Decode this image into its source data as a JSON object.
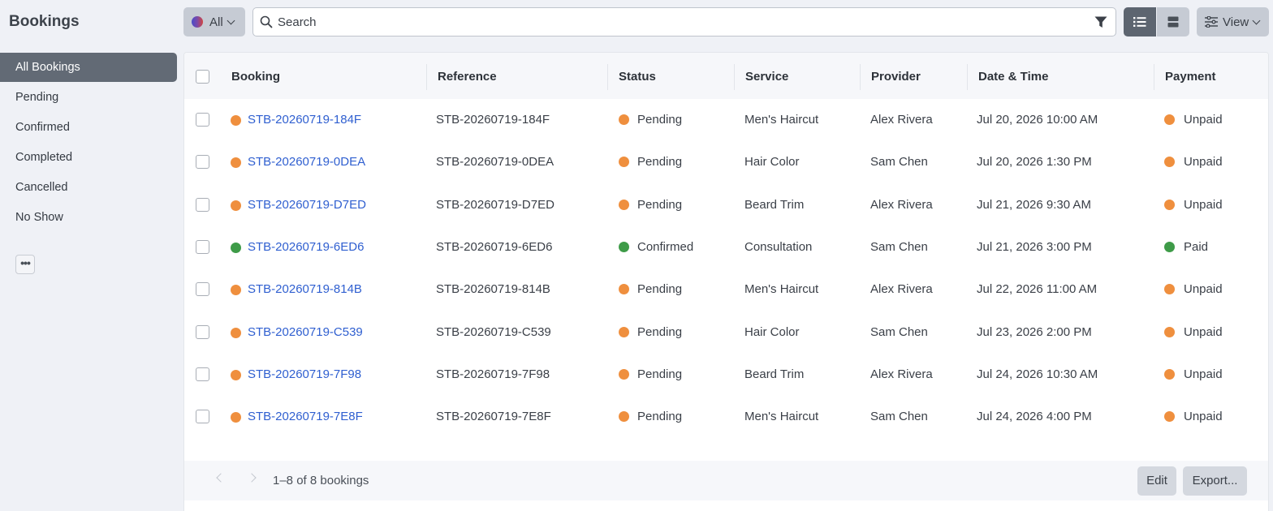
{
  "app": {
    "title": "Bookings"
  },
  "sidebar": {
    "items": [
      {
        "label": "All Bookings"
      },
      {
        "label": "Pending"
      },
      {
        "label": "Confirmed"
      },
      {
        "label": "Completed"
      },
      {
        "label": "Cancelled"
      },
      {
        "label": "No Show"
      }
    ],
    "active": "All Bookings",
    "more_label": "•••"
  },
  "toolbar": {
    "scope_label": "All",
    "search_placeholder": "Search",
    "view_label": "View",
    "active_view": "list"
  },
  "table": {
    "headers": {
      "booking": "Booking",
      "reference": "Reference",
      "status": "Status",
      "service": "Service",
      "provider": "Provider",
      "datetime": "Date & Time",
      "payment": "Payment"
    },
    "rows": [
      {
        "booking": "STB-20260719-184F",
        "reference": "STB-20260719-184F",
        "status": "Pending",
        "service": "Men's Haircut",
        "provider": "Alex Rivera",
        "datetime": "Jul 20, 2026 10:00 AM",
        "payment": "Unpaid"
      },
      {
        "booking": "STB-20260719-0DEA",
        "reference": "STB-20260719-0DEA",
        "status": "Pending",
        "service": "Hair Color",
        "provider": "Sam Chen",
        "datetime": "Jul 20, 2026 1:30 PM",
        "payment": "Unpaid"
      },
      {
        "booking": "STB-20260719-D7ED",
        "reference": "STB-20260719-D7ED",
        "status": "Pending",
        "service": "Beard Trim",
        "provider": "Alex Rivera",
        "datetime": "Jul 21, 2026 9:30 AM",
        "payment": "Unpaid"
      },
      {
        "booking": "STB-20260719-6ED6",
        "reference": "STB-20260719-6ED6",
        "status": "Confirmed",
        "service": "Consultation",
        "provider": "Sam Chen",
        "datetime": "Jul 21, 2026 3:00 PM",
        "payment": "Paid"
      },
      {
        "booking": "STB-20260719-814B",
        "reference": "STB-20260719-814B",
        "status": "Pending",
        "service": "Men's Haircut",
        "provider": "Alex Rivera",
        "datetime": "Jul 22, 2026 11:00 AM",
        "payment": "Unpaid"
      },
      {
        "booking": "STB-20260719-C539",
        "reference": "STB-20260719-C539",
        "status": "Pending",
        "service": "Hair Color",
        "provider": "Sam Chen",
        "datetime": "Jul 23, 2026 2:00 PM",
        "payment": "Unpaid"
      },
      {
        "booking": "STB-20260719-7F98",
        "reference": "STB-20260719-7F98",
        "status": "Pending",
        "service": "Beard Trim",
        "provider": "Alex Rivera",
        "datetime": "Jul 24, 2026 10:30 AM",
        "payment": "Unpaid"
      },
      {
        "booking": "STB-20260719-7E8F",
        "reference": "STB-20260719-7E8F",
        "status": "Pending",
        "service": "Men's Haircut",
        "provider": "Sam Chen",
        "datetime": "Jul 24, 2026 4:00 PM",
        "payment": "Unpaid"
      }
    ]
  },
  "footer": {
    "pagination_text": "1–8 of 8 bookings",
    "edit_label": "Edit",
    "export_label": "Export..."
  },
  "colors": {
    "pending": "#ef8f3e",
    "confirmed": "#3e9b48",
    "unpaid": "#ef8f3e",
    "paid": "#3e9b48",
    "link": "#2f5fd0",
    "active_nav": "#626a75"
  },
  "icons": {
    "scope": "globe-icon",
    "search": "search-icon",
    "filter": "filter-icon",
    "list_view": "list-view-icon",
    "card_view": "card-view-icon",
    "view_settings": "sliders-icon",
    "prev": "chevron-left-icon",
    "next": "chevron-right-icon"
  }
}
